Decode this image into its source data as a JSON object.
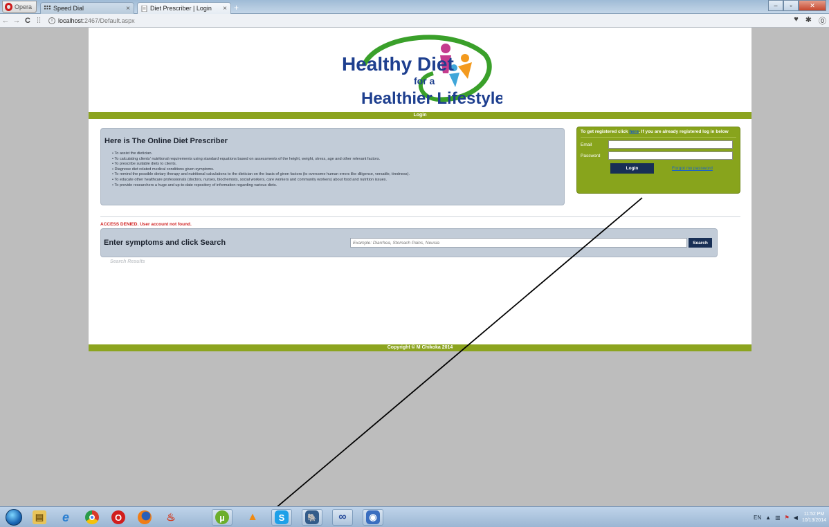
{
  "browser": {
    "menu_label": "Opera",
    "tabs": [
      {
        "title": "Speed Dial",
        "icon": "speed-dial-icon"
      },
      {
        "title": "Diet Prescriber | Login",
        "icon": "page-icon"
      }
    ],
    "new_tab": "+",
    "url_host": "localhost",
    "url_path": ":2467/Default.aspx"
  },
  "page": {
    "logo": {
      "line1": "Healthy Diet",
      "line2": "for a",
      "line3": "Healthier Lifestyle"
    },
    "nav_label": "Login",
    "intro": {
      "title": "Here is The Online Diet Prescriber",
      "items": [
        "To assist the dietician.",
        "To calculating clients' nutritional requirements using standard equations based on assessments of the height, weight, stress, age and other relevant factors.",
        "To prescribe suitable diets to clients.",
        "Diagnose diet related medical conditions given symptoms.",
        "To remind the possible dietary therapy and nutritional calculations to the dietician on the basis of given factors (to overcome human errors like diligence, versatile, tiredness).",
        "To educate other healthcare professionals (doctors, nurses, biochemists, social workers, care workers and community workers) about food and nutrition issues.",
        "To provide researchers a huge and up-to-date repository of information regarding various diets."
      ]
    },
    "login": {
      "register_prefix": "To get registered click ",
      "register_link": "here",
      "register_suffix": ". If you are already registered log in below",
      "email_label": "Email",
      "password_label": "Password",
      "email_value": "",
      "password_value": "",
      "button": "Login",
      "forgot": "Forgot my password"
    },
    "access_message": "ACCESS DENIED. User account not found.",
    "search": {
      "label": "Enter symptoms and click Search",
      "placeholder": "Example: Diarrhea, Stomach Pains, Neusia",
      "button": "Search",
      "results_label": "Search Results"
    },
    "footer": "Copyright © M Chikoka 2014"
  },
  "taskbar": {
    "apps": [
      "folder-icon",
      "ie-icon",
      "chrome-icon",
      "opera-icon",
      "firefox-icon",
      "java-icon",
      "utorrent-icon",
      "vlc-icon",
      "skype-icon",
      "postgres-icon",
      "infinity-icon",
      "media-icon"
    ],
    "language": "EN",
    "time": "11:52 PM",
    "date": "10/13/2014"
  },
  "colors": {
    "accent_green": "#8ca41f",
    "panel_blue": "#c2ccd8",
    "button_navy": "#182f55",
    "error_red": "#d02020"
  }
}
